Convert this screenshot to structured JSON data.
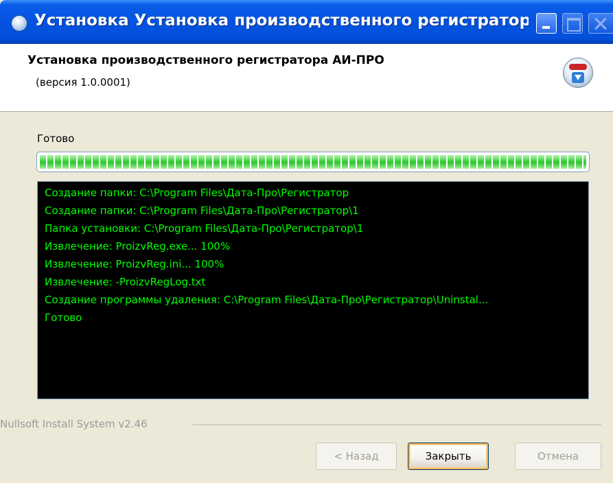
{
  "window": {
    "title": "Установка Установка производственного регистратора: Оне...",
    "colors": {
      "titlebar": "#0453E0",
      "log_background": "#000000",
      "log_text": "#00ff00",
      "progress": "#39d33a"
    }
  },
  "header": {
    "title": "Установка производственного регистратора АИ-ПРО",
    "version": "(версия 1.0.0001)",
    "logo_icon": "nsis-installer-icon"
  },
  "status": {
    "text": "Готово",
    "progress_percent": 100
  },
  "log": {
    "lines": [
      "Создание папки: C:\\Program Files\\Дата-Про\\Регистратор",
      "Создание папки: C:\\Program Files\\Дата-Про\\Регистратор\\1",
      "Папка установки: C:\\Program Files\\Дата-Про\\Регистратор\\1",
      "Извлечение: ProizvReg.exe... 100%",
      "Извлечение: ProizvReg.ini... 100%",
      "Извлечение: -ProizvRegLog.txt",
      "Создание программы удаления: C:\\Program Files\\Дата-Про\\Регистратор\\Uninstal...",
      "Готово"
    ]
  },
  "footer": {
    "brand": "Nullsoft Install System v2.46",
    "back_label": "< Назад",
    "close_label": "Закрыть",
    "cancel_label": "Отмена"
  }
}
